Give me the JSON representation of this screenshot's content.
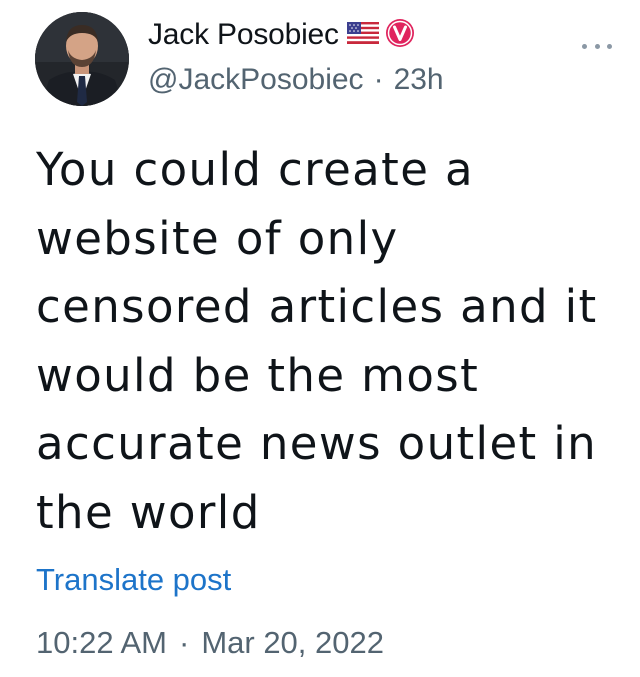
{
  "author": {
    "display_name": "Jack Posobiec",
    "handle": "@JackPosobiec",
    "age": "23h",
    "meta_separator": "·",
    "badges": [
      "us-flag-icon",
      "verified-v-icon"
    ],
    "verified_color": "#e0245e"
  },
  "post": {
    "text": "You could create a\nwebsite of only\ncensored articles and it\nwould be the most\naccurate news outlet in\nthe world",
    "translate_label": "Translate post",
    "time": "10:22 AM",
    "date": "Mar 20, 2022",
    "time_separator": "·"
  },
  "actions": {
    "more_icon": "more-dots-icon"
  },
  "colors": {
    "text": "#0f1419",
    "secondary": "#536471",
    "link": "#1d74c9"
  }
}
